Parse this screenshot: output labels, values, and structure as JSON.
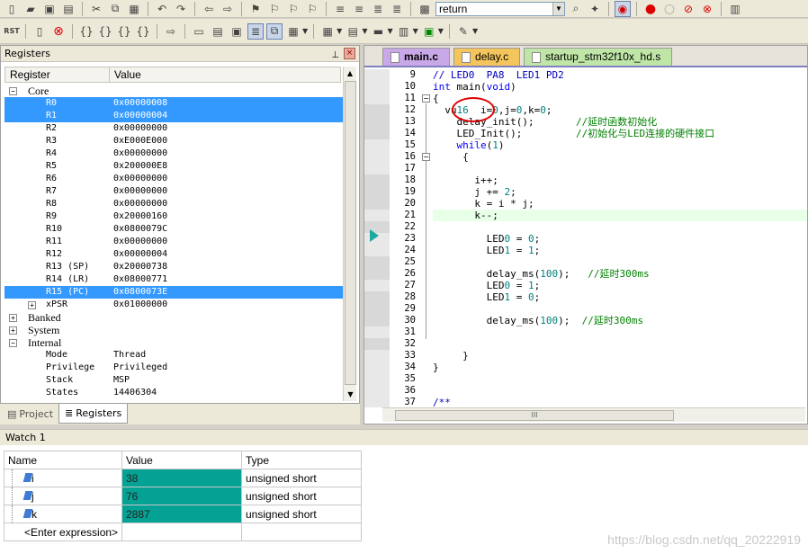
{
  "toolbar": {
    "combo_value": "return"
  },
  "registers_panel": {
    "title": "Registers",
    "col_register": "Register",
    "col_value": "Value",
    "groups": {
      "core": "Core",
      "banked": "Banked",
      "system": "System",
      "internal": "Internal"
    },
    "core": [
      {
        "name": "R0",
        "value": "0x00000008"
      },
      {
        "name": "R1",
        "value": "0x00000004"
      },
      {
        "name": "R2",
        "value": "0x00000000"
      },
      {
        "name": "R3",
        "value": "0xE000E000"
      },
      {
        "name": "R4",
        "value": "0x00000000"
      },
      {
        "name": "R5",
        "value": "0x200000E8"
      },
      {
        "name": "R6",
        "value": "0x00000000"
      },
      {
        "name": "R7",
        "value": "0x00000000"
      },
      {
        "name": "R8",
        "value": "0x00000000"
      },
      {
        "name": "R9",
        "value": "0x20000160"
      },
      {
        "name": "R10",
        "value": "0x0800079C"
      },
      {
        "name": "R11",
        "value": "0x00000000"
      },
      {
        "name": "R12",
        "value": "0x00000004"
      },
      {
        "name": "R13 (SP)",
        "value": "0x20000738"
      },
      {
        "name": "R14 (LR)",
        "value": "0x08000771"
      },
      {
        "name": "R15 (PC)",
        "value": "0x0800073E"
      },
      {
        "name": "xPSR",
        "value": "0x01000000"
      }
    ],
    "internal": [
      {
        "name": "Mode",
        "value": "Thread"
      },
      {
        "name": "Privilege",
        "value": "Privileged"
      },
      {
        "name": "Stack",
        "value": "MSP"
      },
      {
        "name": "States",
        "value": "14406304"
      }
    ],
    "tabs": {
      "project": "Project",
      "registers": "Registers"
    }
  },
  "editor": {
    "tabs": [
      "main.c",
      "delay.c",
      "startup_stm32f10x_hd.s"
    ],
    "line_numbers": [
      "9",
      "10",
      "11",
      "12",
      "13",
      "14",
      "15",
      "16",
      "17",
      "18",
      "19",
      "20",
      "21",
      "22",
      "23",
      "24",
      "25",
      "26",
      "27",
      "28",
      "29",
      "30",
      "31",
      "32",
      "33",
      "34",
      "35",
      "36",
      "37"
    ],
    "lines": [
      "// LED0  PA8  LED1 PD2",
      "int main(void)",
      "{",
      "  vu16  i=0,j=0,k=0;",
      "    delay_init();       //延时函数初始化",
      "    LED_Init();         //初始化与LED连接的硬件接口",
      "    while(1)",
      "     {",
      "",
      "       i++;",
      "       j += 2;",
      "       k = i * j;",
      "       k--;",
      "",
      "         LED0 = 0;",
      "         LED1 = 1;",
      "",
      "         delay_ms(100);   //延时300ms",
      "         LED0 = 1;",
      "         LED1 = 0;",
      "",
      "         delay_ms(100);  //延时300ms",
      "",
      "",
      "     }",
      "}",
      "",
      "",
      "/**"
    ]
  },
  "watch": {
    "title": "Watch 1",
    "headers": [
      "Name",
      "Value",
      "Type"
    ],
    "rows": [
      {
        "name": "i",
        "value": "38",
        "type": "unsigned short"
      },
      {
        "name": "j",
        "value": "76",
        "type": "unsigned short"
      },
      {
        "name": "k",
        "value": "2887",
        "type": "unsigned short"
      }
    ],
    "enter_expression": "<Enter expression>"
  },
  "watermark": "https://blog.csdn.net/qq_20222919",
  "colors": {
    "selection": "#3399ff",
    "watch_value_bg": "#04a295",
    "current_line": "#e8ffe8"
  }
}
